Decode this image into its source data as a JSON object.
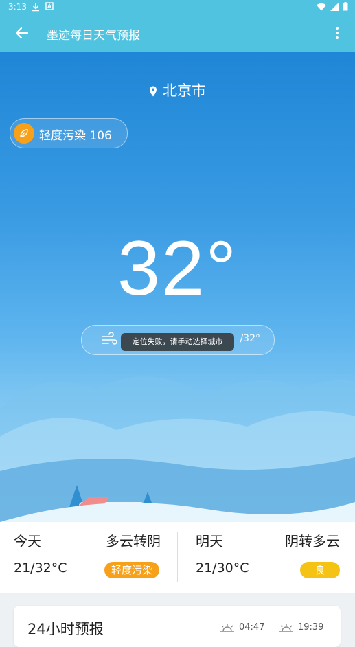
{
  "status": {
    "time": "3:13"
  },
  "appbar": {
    "title": "墨迹每日天气预报"
  },
  "hero": {
    "city": "北京市",
    "aqi": {
      "label": "轻度污染",
      "value": "106"
    },
    "temperature": "32°",
    "wind_range": "/32°",
    "toast": "定位失败，请手动选择城市"
  },
  "today": {
    "name": "今天",
    "condition": "多云转阴",
    "range": "21/32°C",
    "quality": "轻度污染",
    "quality_color": "#f7a11a"
  },
  "tomorrow": {
    "name": "明天",
    "condition": "阴转多云",
    "range": "21/30°C",
    "quality": "良",
    "quality_color": "#f5c313"
  },
  "forecast": {
    "title": "24小时预报",
    "sunrise": "04:47",
    "sunset": "19:39"
  },
  "colors": {
    "primary": "#4fc3e0",
    "sky_top": "#1f86d6"
  }
}
